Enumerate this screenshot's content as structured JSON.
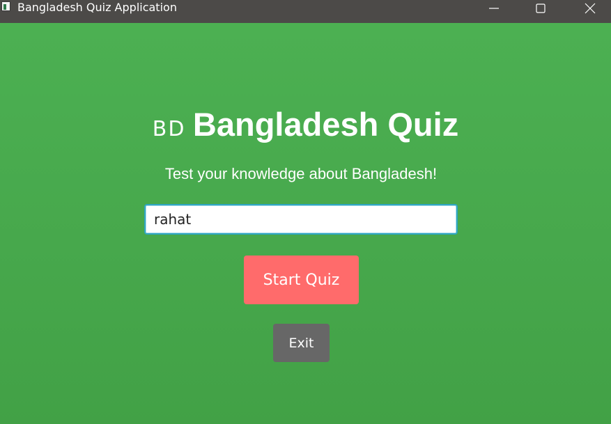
{
  "window": {
    "title": "Bangladesh Quiz Application",
    "controls": [
      "minimize-icon",
      "maximize-icon",
      "close-icon"
    ]
  },
  "header": {
    "flag_text": "BD",
    "title": "Bangladesh Quiz",
    "subtitle": "Test your knowledge about Bangladesh!"
  },
  "form": {
    "name_value": "rahat",
    "start_label": "Start Quiz",
    "exit_label": "Exit"
  },
  "colors": {
    "background": "#4cb052",
    "titlebar": "#4c4a48",
    "start_button": "#ff6b6b",
    "exit_button": "#676767",
    "input_border": "#2fa6c2"
  }
}
